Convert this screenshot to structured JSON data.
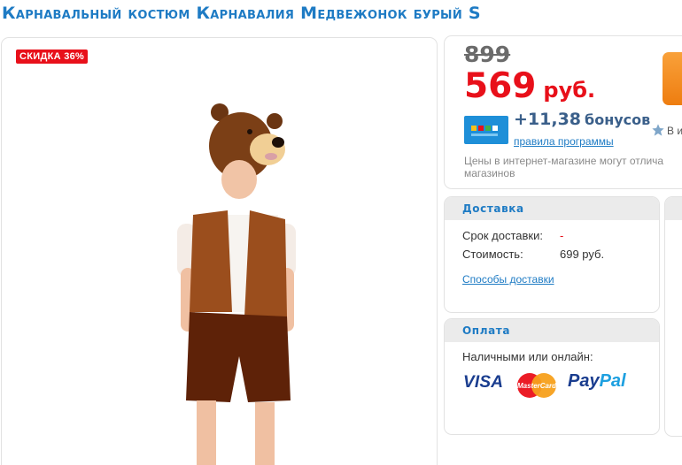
{
  "product": {
    "title": "Карнавальный костюм Карнавалия Медвежонок бурый S",
    "discount_badge": "СКИДКА 36%",
    "image": "product-photo-bear-costume"
  },
  "price": {
    "old": "899",
    "new": "569",
    "currency": "руб.",
    "bonus_amount": "+11,38",
    "bonus_label": "бонусов",
    "bonus_link": "правила программы",
    "star_text": "В и",
    "note": "Цены в интернет-магазине могут отлича магазинов"
  },
  "delivery": {
    "heading": "Доставка",
    "term_label": "Срок доставки:",
    "term_value": "-",
    "cost_label": "Стоимость:",
    "cost_value": "699 руб.",
    "link": "Способы доставки"
  },
  "payment": {
    "heading": "Оплата",
    "text": "Наличными или онлайн:",
    "visa": "VISA",
    "mastercard": "MasterCard",
    "paypal_pay": "Pay",
    "paypal_pal": "Pal"
  },
  "colors": {
    "accent_blue": "#1e7bc4",
    "price_red": "#e8101a",
    "buy_orange": "#ee7d10"
  }
}
